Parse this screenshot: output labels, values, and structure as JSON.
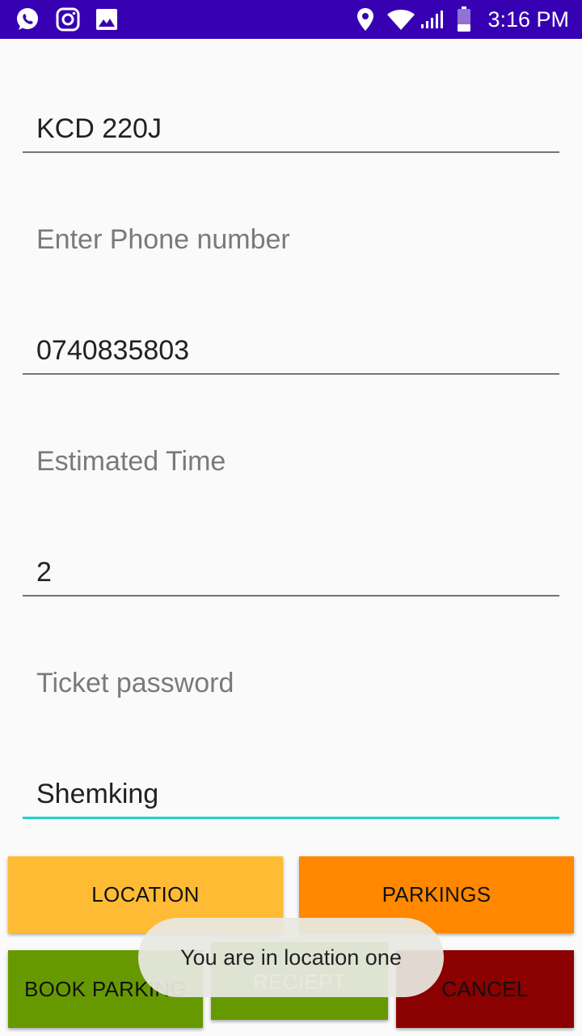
{
  "status_bar": {
    "time": "3:16 PM",
    "bg_color": "#3700b3",
    "left_icons": [
      "whatsapp-icon",
      "instagram-icon",
      "gallery-icon"
    ],
    "right_icons": [
      "location-pin-icon",
      "wifi-icon",
      "signal-icon",
      "battery-icon"
    ]
  },
  "form": {
    "vehicle": {
      "value": "KCD 220J"
    },
    "phone": {
      "label": "Enter Phone number",
      "value": "0740835803"
    },
    "time": {
      "label": "Estimated Time",
      "value": "2"
    },
    "password": {
      "label": "Ticket password",
      "value": "Shemking"
    }
  },
  "buttons": {
    "location": {
      "label": "LOCATION",
      "color": "#ffbb33"
    },
    "parkings": {
      "label": "PARKINGS",
      "color": "#ff8800"
    },
    "book": {
      "label": "BOOK PARKING",
      "color": "#669900"
    },
    "receipt": {
      "label": "RECIEPT",
      "color": "#669900"
    },
    "cancel": {
      "label": "CANCEL",
      "color": "#8b0000"
    }
  },
  "toast": {
    "message": "You are in location one"
  },
  "colors": {
    "accent": "#1fd3c6",
    "background": "#fafafa"
  }
}
